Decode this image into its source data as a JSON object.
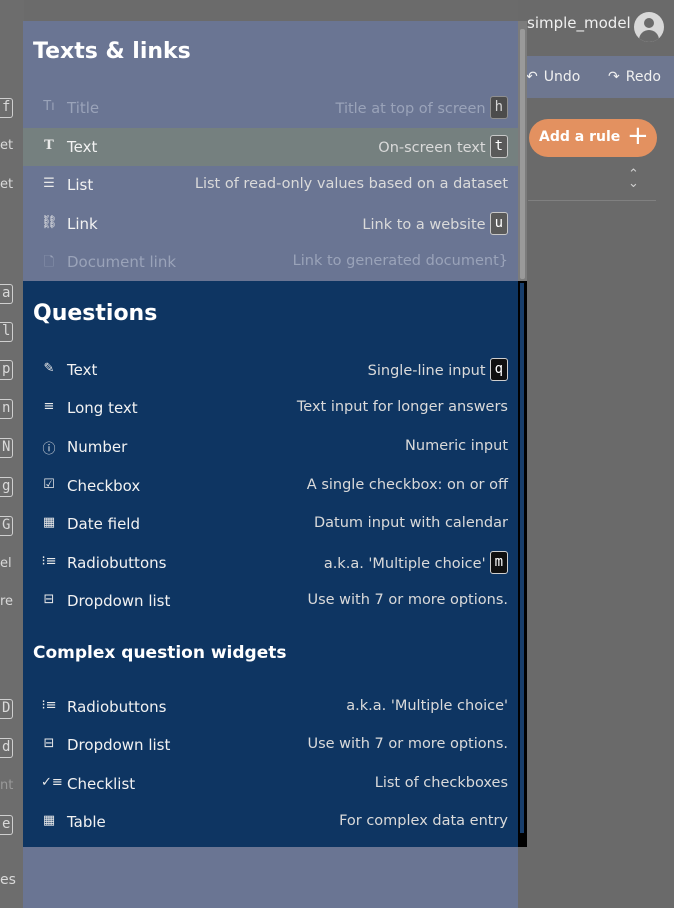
{
  "background": {
    "user_name": "simple_model",
    "toolbar": {
      "undo_label": "Undo",
      "redo_label": "Redo",
      "undo_icon": "undo-icon",
      "redo_icon": "redo-icon"
    },
    "add_rule": {
      "label": "Add a rule",
      "icon": "plus-icon"
    },
    "left_fragments": [
      "f",
      "et",
      "et",
      "a",
      "l",
      "p",
      "n",
      "N",
      "g",
      "G",
      "el",
      "re",
      "D",
      "d",
      "nt",
      "e",
      "es"
    ]
  },
  "menu": {
    "texts_links": {
      "title": "Texts & links",
      "items": [
        {
          "icon": "title-icon",
          "label": "Title",
          "description": "Title at top of screen",
          "shortcut": "h",
          "state": "disabled"
        },
        {
          "icon": "text-icon",
          "label": "Text",
          "description": "On-screen text",
          "shortcut": "t",
          "state": "highlighted"
        },
        {
          "icon": "list-icon",
          "label": "List",
          "description": "List of read-only values based on a dataset",
          "shortcut": "",
          "state": "normal"
        },
        {
          "icon": "link-icon",
          "label": "Link",
          "description": "Link to a website",
          "shortcut": "u",
          "state": "normal"
        },
        {
          "icon": "document-link-icon",
          "label": "Document link",
          "description": "Link to generated document}",
          "shortcut": "",
          "state": "disabled"
        }
      ]
    },
    "questions": {
      "title": "Questions",
      "items": [
        {
          "icon": "pencil-icon",
          "label": "Text",
          "description": "Single-line input",
          "shortcut": "q"
        },
        {
          "icon": "long-text-icon",
          "label": "Long text",
          "description": "Text input for longer answers",
          "shortcut": ""
        },
        {
          "icon": "number-icon",
          "label": "Number",
          "description": "Numeric input",
          "shortcut": ""
        },
        {
          "icon": "checkbox-icon",
          "label": "Checkbox",
          "description": "A single checkbox: on or off",
          "shortcut": ""
        },
        {
          "icon": "calendar-icon",
          "label": "Date field",
          "description": "Datum input with calendar",
          "shortcut": ""
        },
        {
          "icon": "radio-list-icon",
          "label": "Radiobuttons",
          "description": "a.k.a. 'Multiple choice'",
          "shortcut": "m"
        },
        {
          "icon": "dropdown-icon",
          "label": "Dropdown list",
          "description": "Use with 7 or more options.",
          "shortcut": ""
        }
      ]
    },
    "complex": {
      "title": "Complex question widgets",
      "items": [
        {
          "icon": "radio-list-icon",
          "label": "Radiobuttons",
          "description": "a.k.a. 'Multiple choice'",
          "shortcut": ""
        },
        {
          "icon": "dropdown-icon",
          "label": "Dropdown list",
          "description": "Use with 7 or more options.",
          "shortcut": ""
        },
        {
          "icon": "checklist-icon",
          "label": "Checklist",
          "description": "List of checkboxes",
          "shortcut": ""
        },
        {
          "icon": "table-icon",
          "label": "Table",
          "description": "For complex data entry",
          "shortcut": ""
        }
      ]
    }
  }
}
